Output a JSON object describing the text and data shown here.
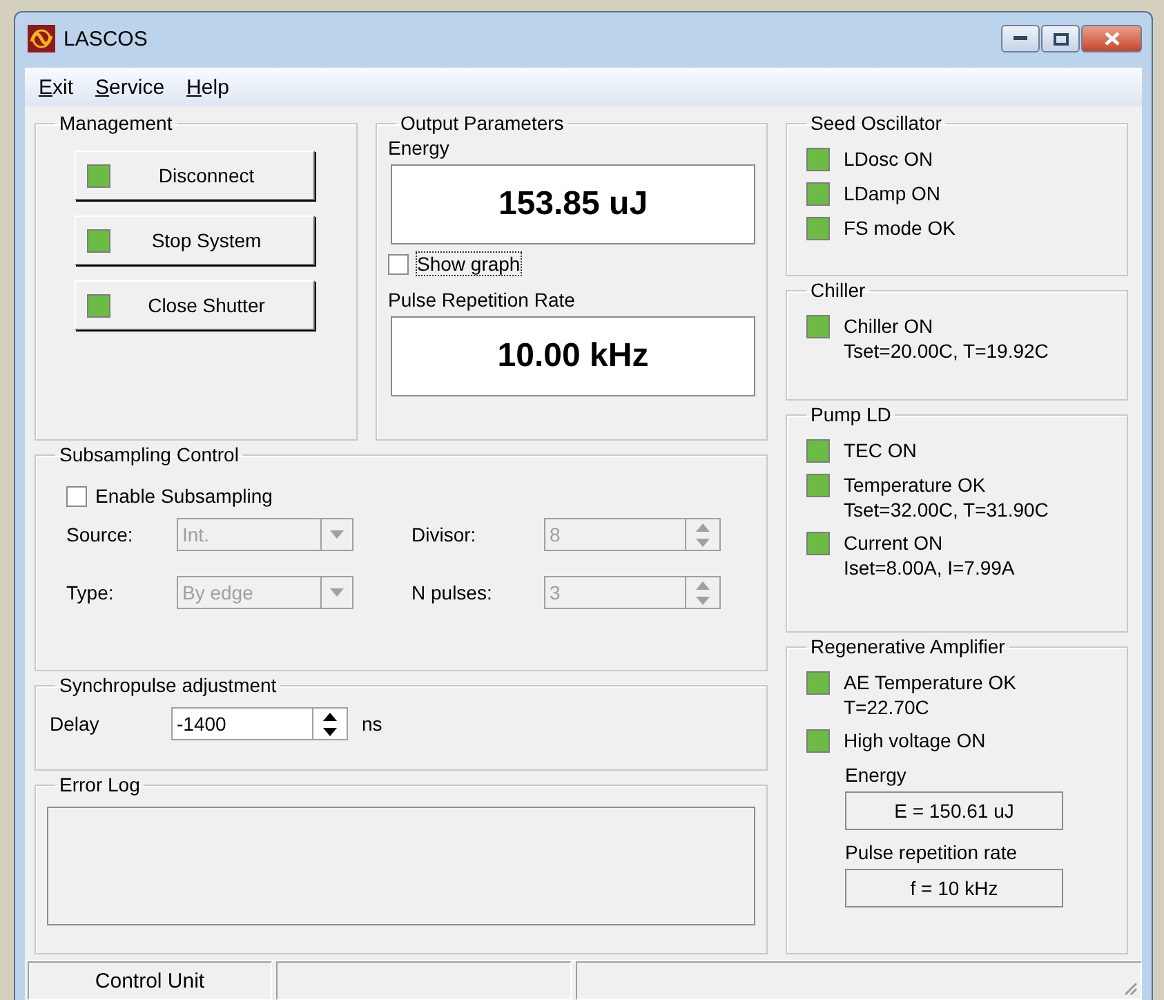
{
  "window": {
    "title": "LASCOS"
  },
  "menu": [
    {
      "label": "Exit"
    },
    {
      "label": "Service"
    },
    {
      "label": "Help"
    }
  ],
  "management": {
    "title": "Management",
    "buttons": [
      {
        "label": "Disconnect",
        "on": true
      },
      {
        "label": "Stop System",
        "on": true
      },
      {
        "label": "Close Shutter",
        "on": true
      }
    ]
  },
  "output": {
    "title": "Output Parameters",
    "energy_label": "Energy",
    "energy_value": "153.85 uJ",
    "show_graph": {
      "label": "Show graph",
      "checked": false
    },
    "rate_label": "Pulse Repetition Rate",
    "rate_value": "10.00 kHz"
  },
  "subsampling": {
    "title": "Subsampling Control",
    "enable": {
      "label": "Enable Subsampling",
      "checked": false
    },
    "fields": [
      {
        "kind": "combo",
        "label": "Source:",
        "value": "Int.",
        "disabled": true
      },
      {
        "kind": "spin",
        "label": "Divisor:",
        "value": "8",
        "disabled": true
      },
      {
        "kind": "combo",
        "label": "Type:",
        "value": "By edge",
        "disabled": true
      },
      {
        "kind": "spin",
        "label": "N pulses:",
        "value": "3",
        "disabled": true
      }
    ]
  },
  "sync": {
    "title": "Synchropulse adjustment",
    "label": "Delay",
    "value": "-1400",
    "unit": "ns"
  },
  "error_log": {
    "title": "Error Log"
  },
  "status_groups": [
    {
      "title": "Seed Oscillator",
      "items": [
        {
          "kind": "indicator",
          "label": "LDosc ON",
          "on": true
        },
        {
          "kind": "indicator",
          "label": "LDamp ON",
          "on": true
        },
        {
          "kind": "indicator",
          "label": "FS mode OK",
          "on": true
        }
      ]
    },
    {
      "title": "Chiller",
      "items": [
        {
          "kind": "indicator",
          "label": "Chiller ON",
          "detail": "Tset=20.00C, T=19.92C",
          "on": true
        }
      ]
    },
    {
      "title": "Pump LD",
      "items": [
        {
          "kind": "indicator",
          "label": "TEC ON",
          "on": true
        },
        {
          "kind": "indicator",
          "label": "Temperature OK",
          "detail": "Tset=32.00C, T=31.90C",
          "on": true
        },
        {
          "kind": "indicator",
          "label": "Current ON",
          "detail": "Iset=8.00A, I=7.99A",
          "on": true
        }
      ]
    },
    {
      "title": "Regenerative Amplifier",
      "items": [
        {
          "kind": "indicator",
          "label": "AE Temperature OK",
          "detail": "T=22.70C",
          "on": true
        },
        {
          "kind": "indicator",
          "label": "High voltage ON",
          "on": true
        },
        {
          "kind": "readout",
          "label": "Energy",
          "value": "E = 150.61 uJ"
        },
        {
          "kind": "readout",
          "label": "Pulse repetition rate",
          "value": "f = 10 kHz"
        }
      ]
    }
  ],
  "status_bar": {
    "text": "Control Unit"
  }
}
